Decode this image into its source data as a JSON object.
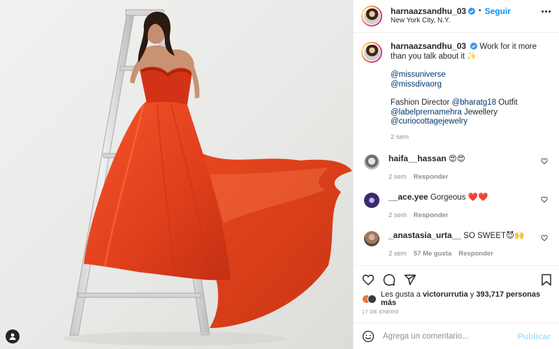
{
  "post": {
    "username": "harnaazsandhu_03",
    "follow_label": "Seguir",
    "location": "New York City, N.Y.",
    "more_icon": "more-horizontal-icon"
  },
  "caption": {
    "username": "harnaazsandhu_03",
    "text": "Work for it more than you talk about it ✨",
    "mention_1": "@missuniverse",
    "mention_2": "@missdivaorg",
    "credit_prefix": "Fashion Director ",
    "credit_mention_1": "@bharatg18",
    "credit_suffix_1": " Outfit",
    "credit_mention_2": "@labelprernamehra",
    "credit_suffix_2": " Jewellery",
    "credit_mention_3": "@curiocottagejewelry",
    "time": "2 sem"
  },
  "comments": [
    {
      "username": "haifa__hassan",
      "text": "😍😍",
      "time": "2 sem",
      "likes": "",
      "reply": "Responder",
      "avatar_color": "#6d6d6d"
    },
    {
      "username": "__ace.yee",
      "text": "Gorgeous ❤️❤️",
      "time": "2 sem",
      "likes": "",
      "reply": "Responder",
      "avatar_color": "#3a2a6b"
    },
    {
      "username": "_anastasia_urta__",
      "text": "SO SWEET😈🙌",
      "time": "2 sem",
      "likes": "57 Me gusta",
      "reply": "Responder",
      "avatar_color": "#9b7b62"
    }
  ],
  "likes": {
    "prefix": "Les gusta a ",
    "user": "victorurrutia",
    "middle": " y ",
    "count": "393,717 personas más"
  },
  "date": "17 DE ENERO",
  "add_comment": {
    "placeholder": "Agrega un comentario...",
    "publish_label": "Publicar"
  },
  "colors": {
    "accent": "#0095f6",
    "link": "#00376b",
    "muted": "#8e8e8e",
    "dress": "#e8401c",
    "publish_disabled": "#b2dffc"
  }
}
